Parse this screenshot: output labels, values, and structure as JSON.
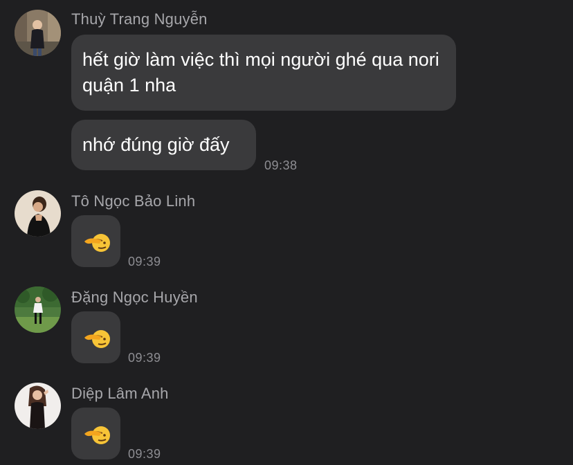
{
  "messages": [
    {
      "sender": "Thuỳ Trang Nguyễn",
      "avatar_icon": "user-avatar-photo",
      "bubbles": [
        {
          "text": "hết giờ làm việc thì mọi người ghé qua nori quận 1 nha"
        },
        {
          "text": "nhớ đúng giờ đấy",
          "time": "09:38"
        }
      ]
    },
    {
      "sender": "Tô Ngọc Bảo Linh",
      "avatar_icon": "user-avatar-photo",
      "reaction_icon": "saluting-face-emoji",
      "time": "09:39"
    },
    {
      "sender": "Đặng Ngọc Huyền",
      "avatar_icon": "user-avatar-photo",
      "reaction_icon": "saluting-face-emoji",
      "time": "09:39"
    },
    {
      "sender": "Diệp Lâm Anh",
      "avatar_icon": "user-avatar-photo",
      "reaction_icon": "saluting-face-emoji",
      "time": "09:39"
    }
  ],
  "colors": {
    "background": "#1f1f21",
    "bubble": "#3a3a3c",
    "sender_name": "#a7a7ab",
    "timestamp": "#8e8e93",
    "message_text": "#ffffff"
  }
}
